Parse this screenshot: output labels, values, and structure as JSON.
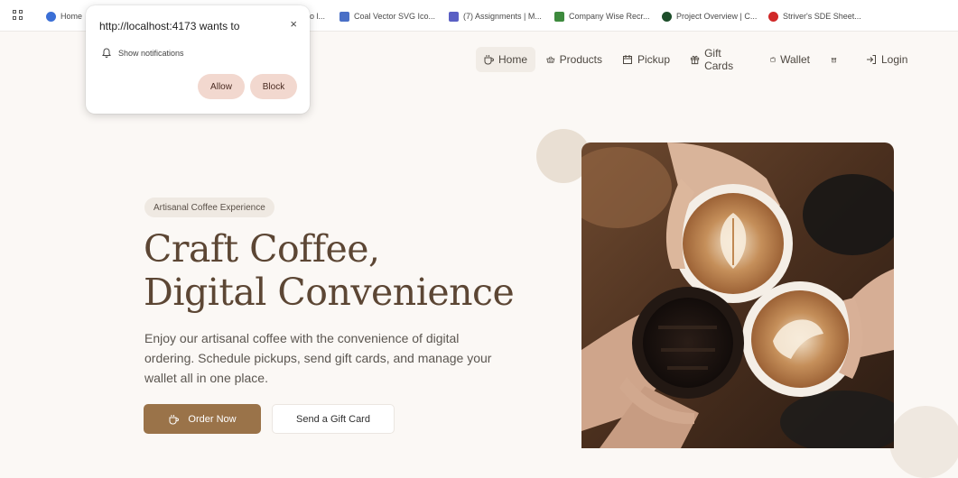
{
  "bookmarks": [
    {
      "label": "Home",
      "color": "#3b6fd6"
    },
    {
      "label": "o l...",
      "color": "#ffffff"
    },
    {
      "label": "Coal Vector SVG Ico...",
      "color": "#4a6fc6"
    },
    {
      "label": "(7) Assignments | M...",
      "color": "#5a5fc4"
    },
    {
      "label": "Company Wise Recr...",
      "color": "#3d8a3d"
    },
    {
      "label": "Project Overview | C...",
      "color": "#1d4d2a"
    },
    {
      "label": "Striver's SDE Sheet...",
      "color": "#d02828"
    }
  ],
  "popup": {
    "title": "http://localhost:4173 wants to",
    "close": "×",
    "permission": "Show notifications",
    "allow": "Allow",
    "block": "Block"
  },
  "nav": {
    "home": "Home",
    "products": "Products",
    "pickup": "Pickup",
    "gift_cards": "Gift Cards",
    "wallet": "Wallet",
    "login": "Login"
  },
  "hero": {
    "badge": "Artisanal Coffee Experience",
    "title_line1": "Craft Coffee,",
    "title_line2": "Digital Convenience",
    "description": "Enjoy our artisanal coffee with the convenience of digital ordering. Schedule pickups, send gift cards, and manage your wallet all in one place.",
    "order_button": "Order Now",
    "gift_button": "Send a Gift Card"
  },
  "colors": {
    "accent": "#9a7349",
    "title": "#5c4634",
    "background": "#fbf8f5",
    "popup_button": "#f2d8cf"
  }
}
